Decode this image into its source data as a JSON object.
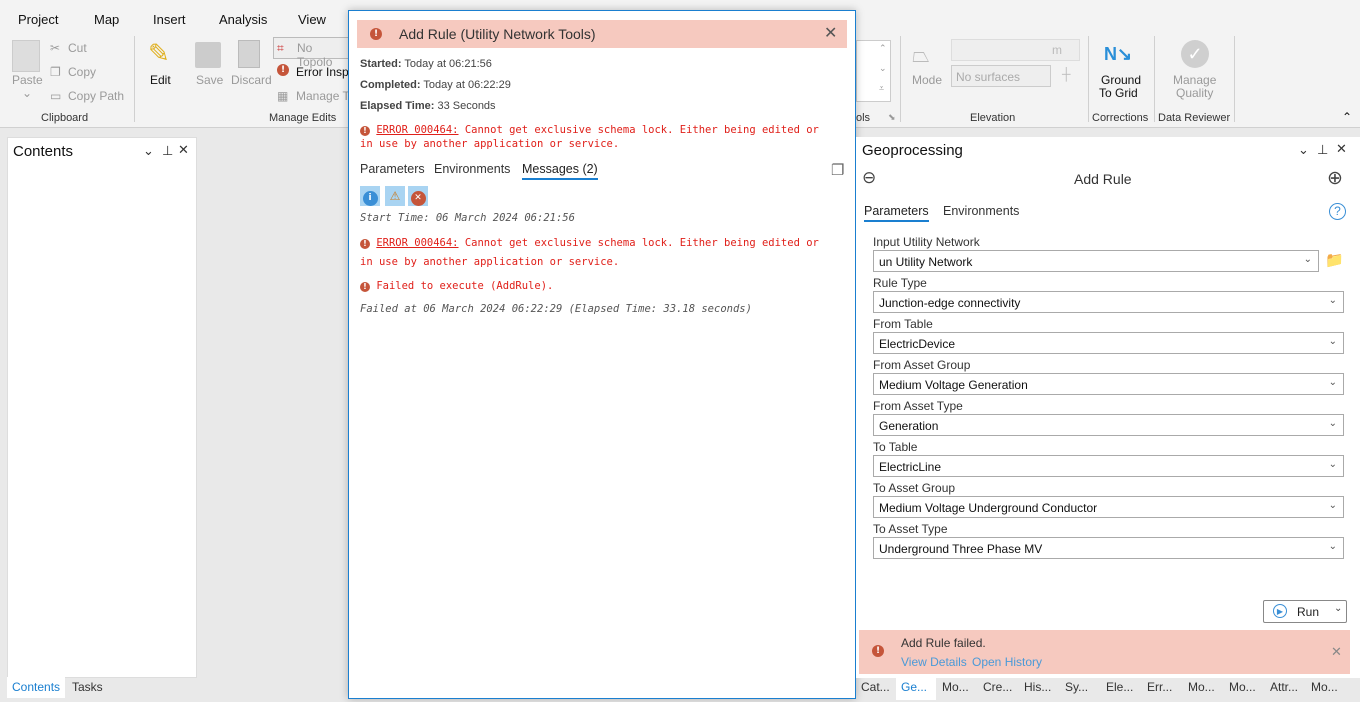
{
  "ribbon": {
    "tabs": [
      "Project",
      "Map",
      "Insert",
      "Analysis",
      "View"
    ],
    "clipboard": {
      "paste": "Paste",
      "cut": "Cut",
      "copy": "Copy",
      "copy_path": "Copy Path",
      "group": "Clipboard"
    },
    "manage_edits": {
      "edit": "Edit",
      "save": "Save",
      "discard": "Discard",
      "no_topology": "No Topolo",
      "error_inspector": "Error Inspe",
      "manage_t": "Manage T",
      "group": "Manage Edits"
    },
    "tools_group": "ols",
    "elevation": {
      "mode": "Mode",
      "units": "m",
      "surfaces": "No surfaces",
      "group": "Elevation"
    },
    "corrections": {
      "ground_to_grid": "Ground",
      "ground_to_grid2": "To Grid",
      "group": "Corrections"
    },
    "data_reviewer": {
      "manage": "Manage",
      "quality": "Quality",
      "group": "Data Reviewer"
    }
  },
  "contents": {
    "title": "Contents",
    "tabs": [
      "Contents",
      "Tasks"
    ]
  },
  "dialog": {
    "title": "Add Rule (Utility Network Tools)",
    "started_label": "Started:",
    "started": "Today at 06:21:56",
    "completed_label": "Completed:",
    "completed": "Today at 06:22:29",
    "elapsed_label": "Elapsed Time:",
    "elapsed": "33 Seconds",
    "error_code": "ERROR 000464:",
    "error_text": "Cannot get exclusive schema lock.  Either being edited or in use by another application or service.",
    "tabs": [
      "Parameters",
      "Environments",
      "Messages (2)"
    ],
    "messages": {
      "start": "Start Time: 06 March 2024 06:21:56",
      "error_code": "ERROR 000464:",
      "error_line1": "Cannot get exclusive schema lock.  Either being edited or",
      "error_line2": "in use by another application or service.",
      "failed": "Failed to execute (AddRule).",
      "failed_at": "Failed at 06 March 2024 06:22:29 (Elapsed Time: 33.18 seconds)"
    }
  },
  "geo": {
    "pane_title": "Geoprocessing",
    "tool_title": "Add Rule",
    "tabs": [
      "Parameters",
      "Environments"
    ],
    "fields": [
      {
        "label": "Input Utility Network",
        "value": "un Utility Network"
      },
      {
        "label": "Rule Type",
        "value": "Junction-edge connectivity"
      },
      {
        "label": "From Table",
        "value": "ElectricDevice"
      },
      {
        "label": "From Asset Group",
        "value": "Medium Voltage Generation"
      },
      {
        "label": "From Asset Type",
        "value": "Generation"
      },
      {
        "label": "To Table",
        "value": "ElectricLine"
      },
      {
        "label": "To Asset Group",
        "value": "Medium Voltage Underground Conductor"
      },
      {
        "label": "To Asset Type",
        "value": "Underground Three Phase MV"
      }
    ],
    "run": "Run",
    "notice": {
      "text": "Add Rule failed.",
      "view_details": "View Details",
      "open_history": "Open History"
    }
  },
  "bottom_tabs": [
    "Cat...",
    "Ge...",
    "Mo...",
    "Cre...",
    "His...",
    "Sy...",
    "Ele...",
    "Err...",
    "Mo...",
    "Mo...",
    "Attr...",
    "Mo..."
  ],
  "colors": {
    "accent": "#1a7fd0",
    "error": "#e0201a",
    "error_bg": "#f6c9bf"
  }
}
